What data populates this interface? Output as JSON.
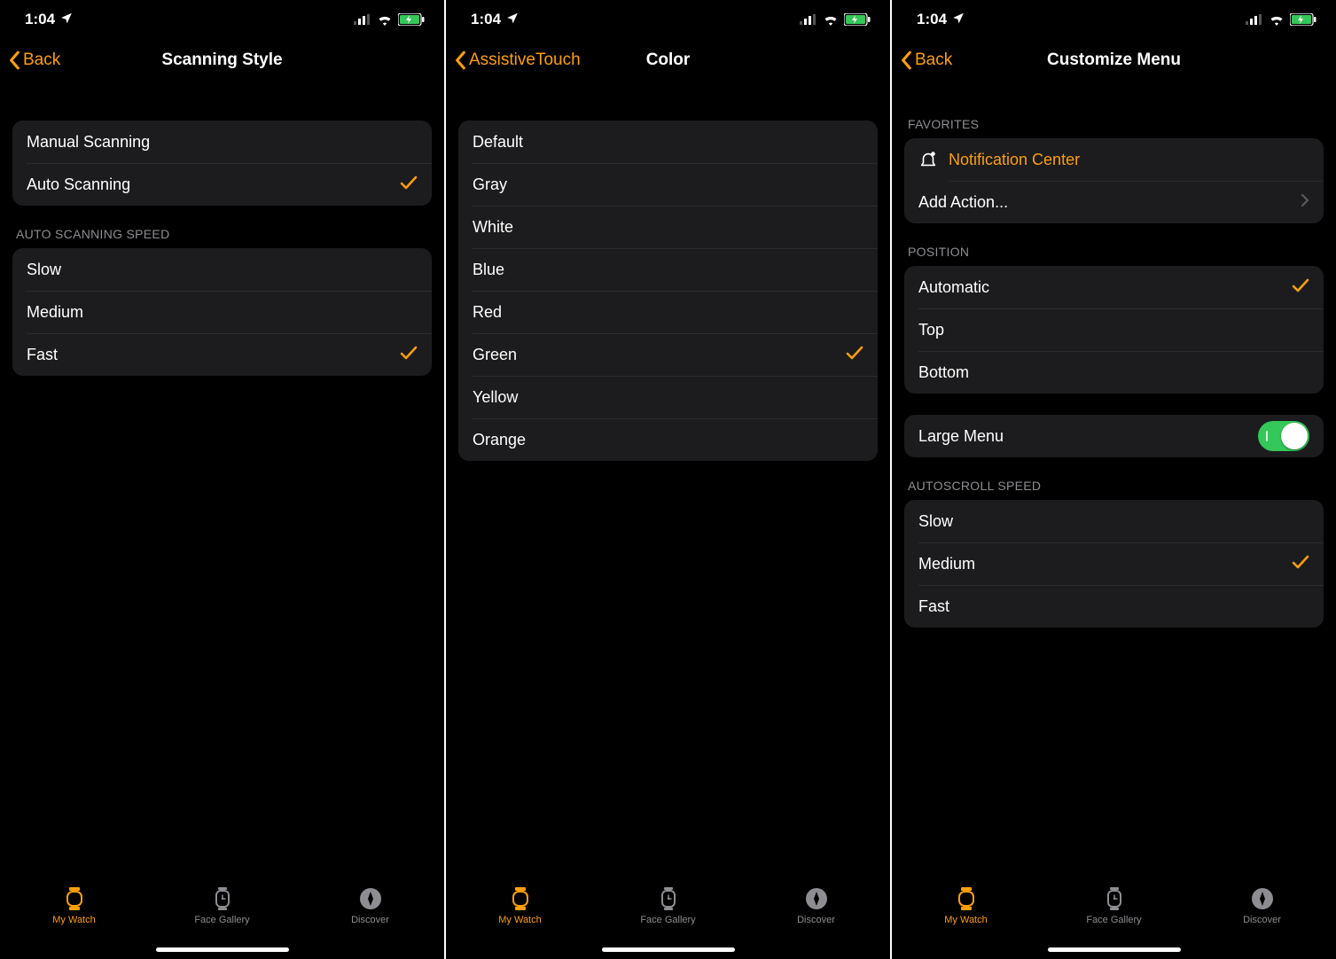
{
  "status": {
    "time": "1:04",
    "signal_bars": 3,
    "wifi": true,
    "battery_charging": true
  },
  "tabs": {
    "my_watch": "My Watch",
    "face_gallery": "Face Gallery",
    "discover": "Discover"
  },
  "screen1": {
    "back_label": "Back",
    "title": "Scanning Style",
    "group1": {
      "items": [
        {
          "label": "Manual Scanning",
          "selected": false
        },
        {
          "label": "Auto Scanning",
          "selected": true
        }
      ]
    },
    "speed_header": "AUTO SCANNING SPEED",
    "speed": {
      "items": [
        {
          "label": "Slow",
          "selected": false
        },
        {
          "label": "Medium",
          "selected": false
        },
        {
          "label": "Fast",
          "selected": true
        }
      ]
    }
  },
  "screen2": {
    "back_label": "AssistiveTouch",
    "title": "Color",
    "colors": {
      "items": [
        {
          "label": "Default",
          "selected": false
        },
        {
          "label": "Gray",
          "selected": false
        },
        {
          "label": "White",
          "selected": false
        },
        {
          "label": "Blue",
          "selected": false
        },
        {
          "label": "Red",
          "selected": false
        },
        {
          "label": "Green",
          "selected": true
        },
        {
          "label": "Yellow",
          "selected": false
        },
        {
          "label": "Orange",
          "selected": false
        }
      ]
    }
  },
  "screen3": {
    "back_label": "Back",
    "title": "Customize Menu",
    "favorites_header": "FAVORITES",
    "favorites": {
      "notification_label": "Notification Center",
      "add_action_label": "Add Action..."
    },
    "position_header": "POSITION",
    "position": {
      "items": [
        {
          "label": "Automatic",
          "selected": true
        },
        {
          "label": "Top",
          "selected": false
        },
        {
          "label": "Bottom",
          "selected": false
        }
      ]
    },
    "large_menu_label": "Large Menu",
    "large_menu_on": true,
    "autoscroll_header": "AUTOSCROLL SPEED",
    "autoscroll": {
      "items": [
        {
          "label": "Slow",
          "selected": false
        },
        {
          "label": "Medium",
          "selected": true
        },
        {
          "label": "Fast",
          "selected": false
        }
      ]
    }
  }
}
